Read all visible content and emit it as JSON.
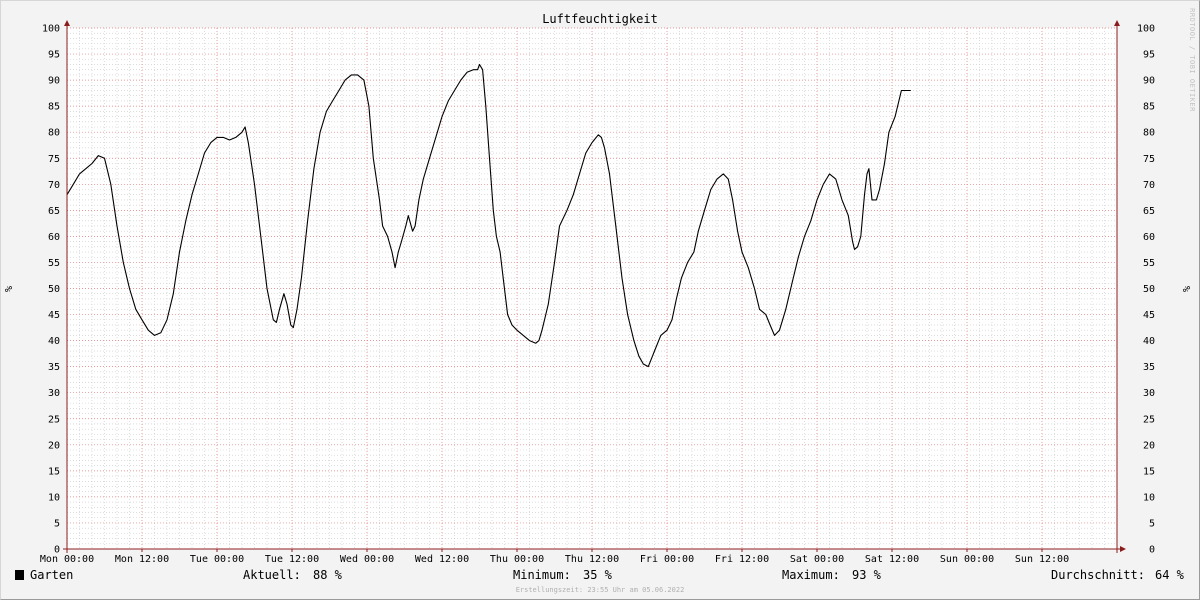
{
  "chart_data": {
    "type": "line",
    "title": "Luftfeuchtigkeit",
    "ylabel": "%",
    "right_ylabel": "%",
    "ylim": [
      0,
      100
    ],
    "y_ticks": [
      0,
      5,
      10,
      15,
      20,
      25,
      30,
      35,
      40,
      45,
      50,
      55,
      60,
      65,
      70,
      75,
      80,
      85,
      90,
      95,
      100
    ],
    "x_hours_range": [
      0,
      168
    ],
    "x_ticks": [
      {
        "h": 0,
        "label": "Mon 00:00"
      },
      {
        "h": 12,
        "label": "Mon 12:00"
      },
      {
        "h": 24,
        "label": "Tue 00:00"
      },
      {
        "h": 36,
        "label": "Tue 12:00"
      },
      {
        "h": 48,
        "label": "Wed 00:00"
      },
      {
        "h": 60,
        "label": "Wed 12:00"
      },
      {
        "h": 72,
        "label": "Thu 00:00"
      },
      {
        "h": 84,
        "label": "Thu 12:00"
      },
      {
        "h": 96,
        "label": "Fri 00:00"
      },
      {
        "h": 108,
        "label": "Fri 12:00"
      },
      {
        "h": 120,
        "label": "Sat 00:00"
      },
      {
        "h": 132,
        "label": "Sat 12:00"
      },
      {
        "h": 144,
        "label": "Sun 00:00"
      },
      {
        "h": 156,
        "label": "Sun 12:00"
      }
    ],
    "grid": true,
    "series": [
      {
        "name": "Garten",
        "color": "#000000",
        "points": [
          [
            0,
            68
          ],
          [
            1,
            70
          ],
          [
            2,
            72
          ],
          [
            3,
            73
          ],
          [
            4,
            74
          ],
          [
            5,
            75.5
          ],
          [
            6,
            75
          ],
          [
            7,
            70
          ],
          [
            8,
            62
          ],
          [
            9,
            55
          ],
          [
            10,
            50
          ],
          [
            11,
            46
          ],
          [
            12,
            44
          ],
          [
            13,
            42
          ],
          [
            14,
            41
          ],
          [
            15,
            41.5
          ],
          [
            16,
            44
          ],
          [
            17,
            49
          ],
          [
            18,
            57
          ],
          [
            19,
            63
          ],
          [
            20,
            68
          ],
          [
            21,
            72
          ],
          [
            22,
            76
          ],
          [
            23,
            78
          ],
          [
            24,
            79
          ],
          [
            25,
            79
          ],
          [
            26,
            78.5
          ],
          [
            27,
            79
          ],
          [
            28,
            80
          ],
          [
            28.5,
            81
          ],
          [
            29,
            78
          ],
          [
            30,
            70
          ],
          [
            31,
            60
          ],
          [
            32,
            50
          ],
          [
            33,
            44
          ],
          [
            33.5,
            43.5
          ],
          [
            34,
            46
          ],
          [
            34.7,
            49
          ],
          [
            35.2,
            47
          ],
          [
            35.8,
            43
          ],
          [
            36.2,
            42.5
          ],
          [
            36.8,
            46
          ],
          [
            37.5,
            52
          ],
          [
            38.5,
            63
          ],
          [
            39.5,
            73
          ],
          [
            40.5,
            80
          ],
          [
            41.5,
            84
          ],
          [
            42.5,
            86
          ],
          [
            43.5,
            88
          ],
          [
            44.5,
            90
          ],
          [
            45.5,
            91
          ],
          [
            46.5,
            91
          ],
          [
            47.5,
            90
          ],
          [
            48.3,
            85
          ],
          [
            49,
            75
          ],
          [
            50,
            67
          ],
          [
            50.5,
            62
          ],
          [
            51.3,
            60
          ],
          [
            52,
            57
          ],
          [
            52.5,
            54
          ],
          [
            53,
            57
          ],
          [
            53.5,
            59
          ],
          [
            54.2,
            62
          ],
          [
            54.6,
            64
          ],
          [
            55.3,
            61
          ],
          [
            55.7,
            62
          ],
          [
            56.3,
            67
          ],
          [
            57,
            71
          ],
          [
            58,
            75
          ],
          [
            59,
            79
          ],
          [
            60,
            83
          ],
          [
            61,
            86
          ],
          [
            62,
            88
          ],
          [
            63,
            90
          ],
          [
            64,
            91.5
          ],
          [
            65,
            92
          ],
          [
            65.7,
            92
          ],
          [
            66,
            93
          ],
          [
            66.5,
            92
          ],
          [
            67,
            85
          ],
          [
            67.6,
            75
          ],
          [
            68.2,
            65
          ],
          [
            68.7,
            60
          ],
          [
            69.3,
            57
          ],
          [
            69.8,
            52
          ],
          [
            70.5,
            45
          ],
          [
            71.2,
            43
          ],
          [
            72,
            42
          ],
          [
            73,
            41
          ],
          [
            74,
            40
          ],
          [
            75,
            39.5
          ],
          [
            75.5,
            40
          ],
          [
            76,
            42
          ],
          [
            77,
            47
          ],
          [
            78,
            55
          ],
          [
            78.8,
            62
          ],
          [
            80,
            65
          ],
          [
            81,
            68
          ],
          [
            82,
            72
          ],
          [
            83,
            76
          ],
          [
            84,
            78
          ],
          [
            85,
            79.5
          ],
          [
            85.5,
            79
          ],
          [
            86,
            77
          ],
          [
            86.8,
            72
          ],
          [
            87.8,
            62
          ],
          [
            88.8,
            52
          ],
          [
            89.7,
            45
          ],
          [
            90.7,
            40
          ],
          [
            91.5,
            37
          ],
          [
            92.2,
            35.5
          ],
          [
            93,
            35
          ],
          [
            93.5,
            36.5
          ],
          [
            94,
            38
          ],
          [
            95,
            41
          ],
          [
            96,
            42
          ],
          [
            96.8,
            44
          ],
          [
            97.5,
            48
          ],
          [
            98.3,
            52
          ],
          [
            99.3,
            55
          ],
          [
            100.3,
            57
          ],
          [
            101,
            61
          ],
          [
            102,
            65
          ],
          [
            103,
            69
          ],
          [
            104,
            71
          ],
          [
            105,
            72
          ],
          [
            105.8,
            71
          ],
          [
            106.5,
            67
          ],
          [
            107.3,
            61
          ],
          [
            108,
            57
          ],
          [
            109,
            54
          ],
          [
            110,
            50
          ],
          [
            110.8,
            46
          ],
          [
            111.8,
            45
          ],
          [
            112.5,
            43
          ],
          [
            113.2,
            41
          ],
          [
            114,
            42
          ],
          [
            115,
            46
          ],
          [
            116,
            51
          ],
          [
            117,
            56
          ],
          [
            118,
            60
          ],
          [
            119,
            63
          ],
          [
            120,
            67
          ],
          [
            121,
            70
          ],
          [
            122,
            72
          ],
          [
            123,
            71
          ],
          [
            124,
            67
          ],
          [
            125,
            64
          ],
          [
            125.7,
            59
          ],
          [
            126,
            57.5
          ],
          [
            126.5,
            58
          ],
          [
            127,
            60
          ],
          [
            127.6,
            68
          ],
          [
            128,
            72
          ],
          [
            128.3,
            73
          ],
          [
            128.8,
            67
          ],
          [
            129.5,
            67
          ],
          [
            130,
            69
          ],
          [
            130.8,
            74
          ],
          [
            131.5,
            80
          ],
          [
            132.5,
            83
          ],
          [
            133.5,
            88
          ],
          [
            134.5,
            88
          ],
          [
            135,
            88
          ]
        ]
      }
    ],
    "legend": {
      "swatch_color": "#000000",
      "series_name": "Garten",
      "aktuell_label": "Aktuell:",
      "aktuell_value": "88 %",
      "minimum_label": "Minimum:",
      "minimum_value": "35 %",
      "maximum_label": "Maximum:",
      "maximum_value": "93 %",
      "avg_label": "Durchschnitt:",
      "avg_value": "64 %"
    },
    "footer": "Erstellungszeit: 23:55 Uhr am 05.06.2022",
    "watermark": "RRDTOOL / TOBI OETIKER",
    "colors": {
      "background": "#f3f3f3",
      "canvas": "#ffffff",
      "major_grid": "#e07878",
      "minor_grid": "#c8c8c8",
      "axis": "#8c1c1c",
      "line": "#000000"
    }
  }
}
